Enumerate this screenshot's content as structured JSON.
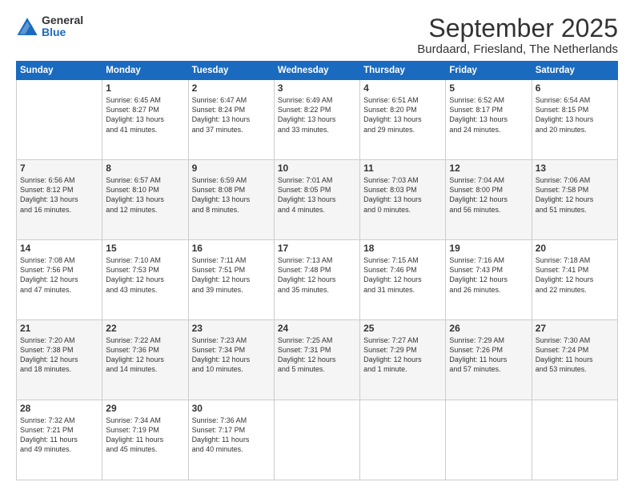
{
  "logo": {
    "general": "General",
    "blue": "Blue"
  },
  "title": "September 2025",
  "location": "Burdaard, Friesland, The Netherlands",
  "days_header": [
    "Sunday",
    "Monday",
    "Tuesday",
    "Wednesday",
    "Thursday",
    "Friday",
    "Saturday"
  ],
  "weeks": [
    [
      {
        "num": "",
        "lines": []
      },
      {
        "num": "1",
        "lines": [
          "Sunrise: 6:45 AM",
          "Sunset: 8:27 PM",
          "Daylight: 13 hours",
          "and 41 minutes."
        ]
      },
      {
        "num": "2",
        "lines": [
          "Sunrise: 6:47 AM",
          "Sunset: 8:24 PM",
          "Daylight: 13 hours",
          "and 37 minutes."
        ]
      },
      {
        "num": "3",
        "lines": [
          "Sunrise: 6:49 AM",
          "Sunset: 8:22 PM",
          "Daylight: 13 hours",
          "and 33 minutes."
        ]
      },
      {
        "num": "4",
        "lines": [
          "Sunrise: 6:51 AM",
          "Sunset: 8:20 PM",
          "Daylight: 13 hours",
          "and 29 minutes."
        ]
      },
      {
        "num": "5",
        "lines": [
          "Sunrise: 6:52 AM",
          "Sunset: 8:17 PM",
          "Daylight: 13 hours",
          "and 24 minutes."
        ]
      },
      {
        "num": "6",
        "lines": [
          "Sunrise: 6:54 AM",
          "Sunset: 8:15 PM",
          "Daylight: 13 hours",
          "and 20 minutes."
        ]
      }
    ],
    [
      {
        "num": "7",
        "lines": [
          "Sunrise: 6:56 AM",
          "Sunset: 8:12 PM",
          "Daylight: 13 hours",
          "and 16 minutes."
        ]
      },
      {
        "num": "8",
        "lines": [
          "Sunrise: 6:57 AM",
          "Sunset: 8:10 PM",
          "Daylight: 13 hours",
          "and 12 minutes."
        ]
      },
      {
        "num": "9",
        "lines": [
          "Sunrise: 6:59 AM",
          "Sunset: 8:08 PM",
          "Daylight: 13 hours",
          "and 8 minutes."
        ]
      },
      {
        "num": "10",
        "lines": [
          "Sunrise: 7:01 AM",
          "Sunset: 8:05 PM",
          "Daylight: 13 hours",
          "and 4 minutes."
        ]
      },
      {
        "num": "11",
        "lines": [
          "Sunrise: 7:03 AM",
          "Sunset: 8:03 PM",
          "Daylight: 13 hours",
          "and 0 minutes."
        ]
      },
      {
        "num": "12",
        "lines": [
          "Sunrise: 7:04 AM",
          "Sunset: 8:00 PM",
          "Daylight: 12 hours",
          "and 56 minutes."
        ]
      },
      {
        "num": "13",
        "lines": [
          "Sunrise: 7:06 AM",
          "Sunset: 7:58 PM",
          "Daylight: 12 hours",
          "and 51 minutes."
        ]
      }
    ],
    [
      {
        "num": "14",
        "lines": [
          "Sunrise: 7:08 AM",
          "Sunset: 7:56 PM",
          "Daylight: 12 hours",
          "and 47 minutes."
        ]
      },
      {
        "num": "15",
        "lines": [
          "Sunrise: 7:10 AM",
          "Sunset: 7:53 PM",
          "Daylight: 12 hours",
          "and 43 minutes."
        ]
      },
      {
        "num": "16",
        "lines": [
          "Sunrise: 7:11 AM",
          "Sunset: 7:51 PM",
          "Daylight: 12 hours",
          "and 39 minutes."
        ]
      },
      {
        "num": "17",
        "lines": [
          "Sunrise: 7:13 AM",
          "Sunset: 7:48 PM",
          "Daylight: 12 hours",
          "and 35 minutes."
        ]
      },
      {
        "num": "18",
        "lines": [
          "Sunrise: 7:15 AM",
          "Sunset: 7:46 PM",
          "Daylight: 12 hours",
          "and 31 minutes."
        ]
      },
      {
        "num": "19",
        "lines": [
          "Sunrise: 7:16 AM",
          "Sunset: 7:43 PM",
          "Daylight: 12 hours",
          "and 26 minutes."
        ]
      },
      {
        "num": "20",
        "lines": [
          "Sunrise: 7:18 AM",
          "Sunset: 7:41 PM",
          "Daylight: 12 hours",
          "and 22 minutes."
        ]
      }
    ],
    [
      {
        "num": "21",
        "lines": [
          "Sunrise: 7:20 AM",
          "Sunset: 7:38 PM",
          "Daylight: 12 hours",
          "and 18 minutes."
        ]
      },
      {
        "num": "22",
        "lines": [
          "Sunrise: 7:22 AM",
          "Sunset: 7:36 PM",
          "Daylight: 12 hours",
          "and 14 minutes."
        ]
      },
      {
        "num": "23",
        "lines": [
          "Sunrise: 7:23 AM",
          "Sunset: 7:34 PM",
          "Daylight: 12 hours",
          "and 10 minutes."
        ]
      },
      {
        "num": "24",
        "lines": [
          "Sunrise: 7:25 AM",
          "Sunset: 7:31 PM",
          "Daylight: 12 hours",
          "and 5 minutes."
        ]
      },
      {
        "num": "25",
        "lines": [
          "Sunrise: 7:27 AM",
          "Sunset: 7:29 PM",
          "Daylight: 12 hours",
          "and 1 minute."
        ]
      },
      {
        "num": "26",
        "lines": [
          "Sunrise: 7:29 AM",
          "Sunset: 7:26 PM",
          "Daylight: 11 hours",
          "and 57 minutes."
        ]
      },
      {
        "num": "27",
        "lines": [
          "Sunrise: 7:30 AM",
          "Sunset: 7:24 PM",
          "Daylight: 11 hours",
          "and 53 minutes."
        ]
      }
    ],
    [
      {
        "num": "28",
        "lines": [
          "Sunrise: 7:32 AM",
          "Sunset: 7:21 PM",
          "Daylight: 11 hours",
          "and 49 minutes."
        ]
      },
      {
        "num": "29",
        "lines": [
          "Sunrise: 7:34 AM",
          "Sunset: 7:19 PM",
          "Daylight: 11 hours",
          "and 45 minutes."
        ]
      },
      {
        "num": "30",
        "lines": [
          "Sunrise: 7:36 AM",
          "Sunset: 7:17 PM",
          "Daylight: 11 hours",
          "and 40 minutes."
        ]
      },
      {
        "num": "",
        "lines": []
      },
      {
        "num": "",
        "lines": []
      },
      {
        "num": "",
        "lines": []
      },
      {
        "num": "",
        "lines": []
      }
    ]
  ]
}
